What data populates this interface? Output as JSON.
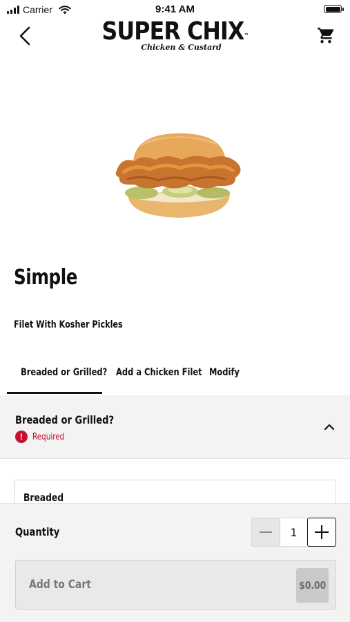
{
  "status_bar": {
    "carrier": "Carrier",
    "time": "9:41 AM"
  },
  "header": {
    "logo_main": "SUPER CHIX",
    "logo_tm": "™",
    "logo_sub": "Chicken & Custard"
  },
  "product": {
    "title": "Simple",
    "description": "Filet With Kosher Pickles"
  },
  "tabs": [
    {
      "label": "Breaded or Grilled?",
      "active": true
    },
    {
      "label": "Add a Chicken Filet",
      "active": false
    },
    {
      "label": "Modify",
      "active": false
    }
  ],
  "section": {
    "title": "Breaded or Grilled?",
    "required_label": "Required",
    "required_icon": "!",
    "accent_color": "#c8102e"
  },
  "options": [
    {
      "label": "Breaded"
    }
  ],
  "quantity": {
    "label": "Quantity",
    "value": "1"
  },
  "cart": {
    "add_label": "Add to Cart",
    "price": "$0.00"
  },
  "icons": {
    "back": "chevron-left-icon",
    "cart": "shopping-cart-icon",
    "collapse": "chevron-up-icon",
    "minus": "minus-icon",
    "plus": "plus-icon"
  }
}
